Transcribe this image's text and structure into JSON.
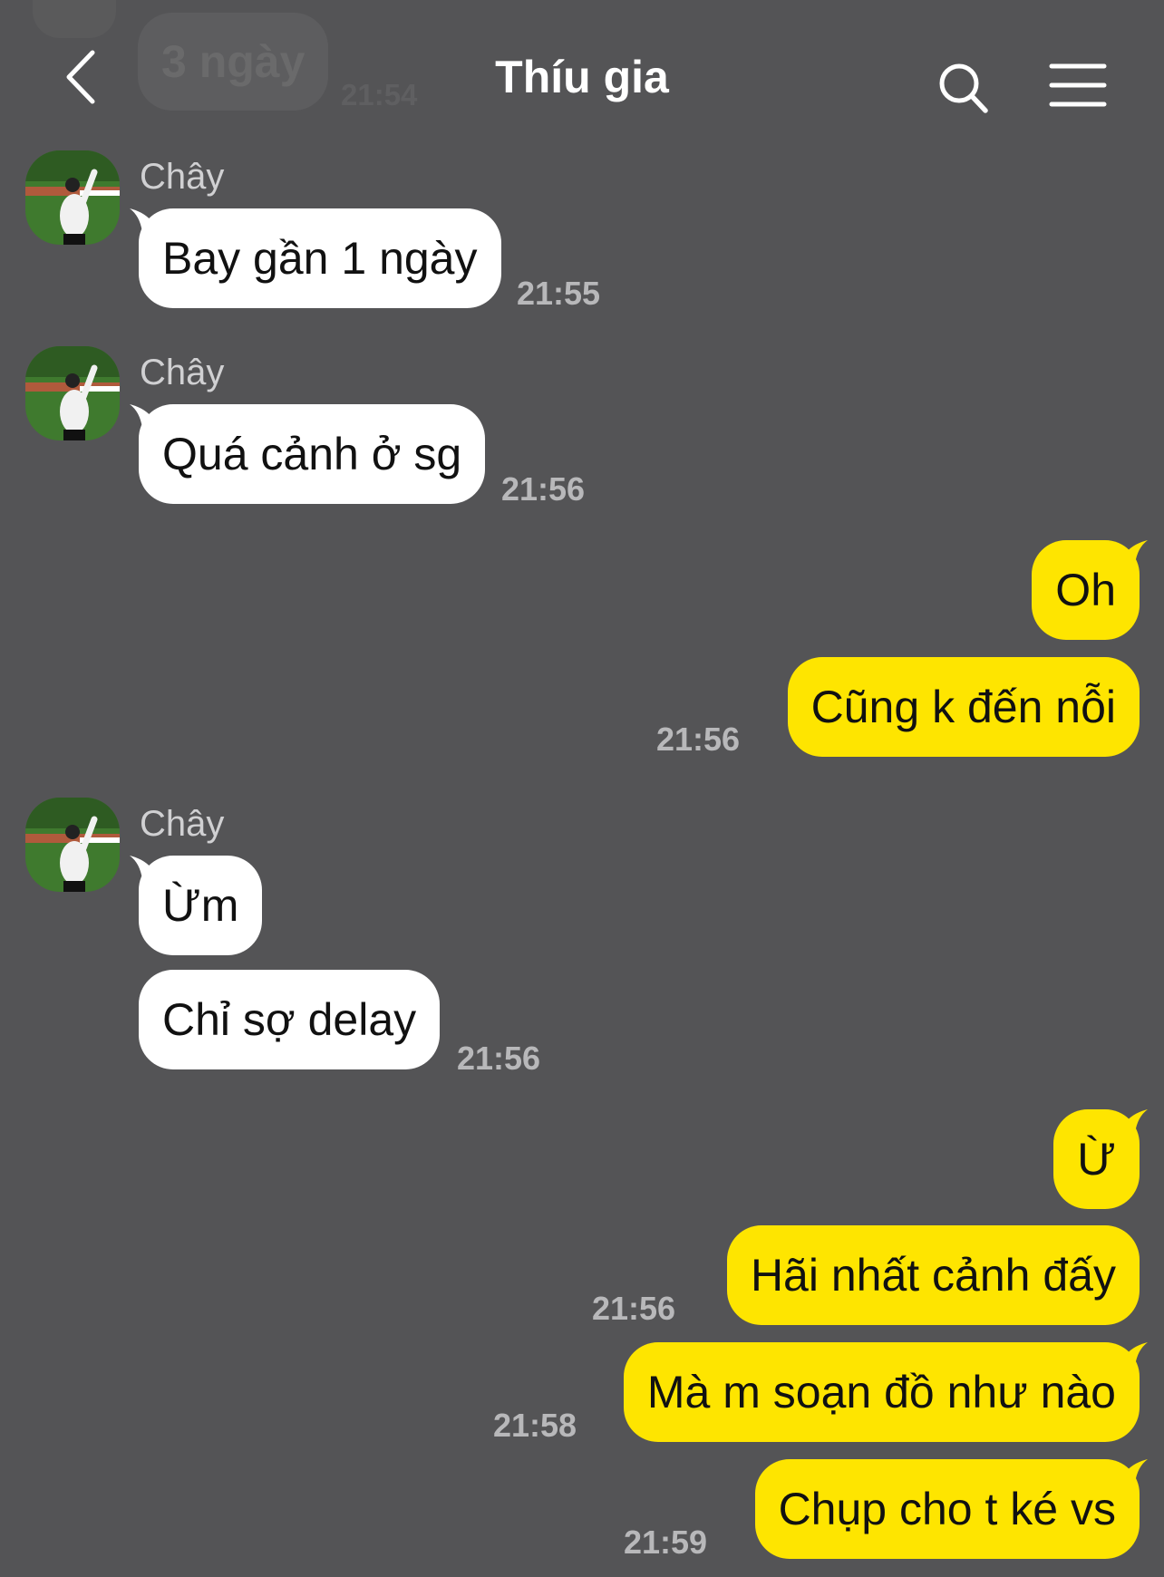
{
  "header": {
    "title": "Thíu gia",
    "back_icon": "chevron-left-icon",
    "search_icon": "search-icon",
    "menu_icon": "hamburger-menu-icon"
  },
  "previous": {
    "text": "3 ngày",
    "time": "21:54"
  },
  "colors": {
    "background": "#545456",
    "incoming": "#ffffff",
    "outgoing": "#fee500",
    "text": "#111111"
  },
  "messages": [
    {
      "sender": "Chây",
      "text": "Bay gần 1 ngày",
      "time": "21:55"
    },
    {
      "sender": "Chây",
      "text": "Quá cảnh ở sg",
      "time": "21:56"
    },
    {
      "text": "Oh"
    },
    {
      "text": "Cũng k đến nỗi",
      "time": "21:56"
    },
    {
      "sender": "Chây",
      "text": "Ừm"
    },
    {
      "text": "Chỉ sợ delay",
      "time": "21:56"
    },
    {
      "text": "Ừ"
    },
    {
      "text": "Hãi nhất cảnh đấy",
      "time": "21:56"
    },
    {
      "text": "Mà m soạn đồ như nào",
      "time": "21:58"
    },
    {
      "text": "Chụp cho t ké vs",
      "time": "21:59"
    }
  ]
}
